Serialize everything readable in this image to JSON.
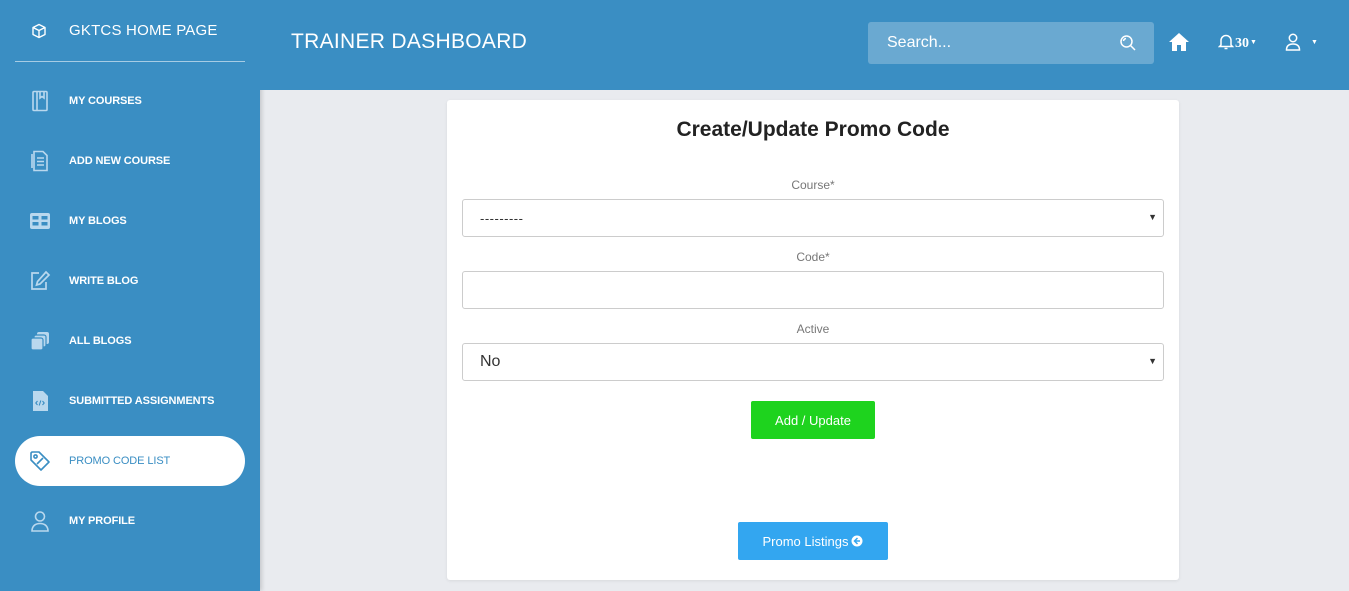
{
  "brand": {
    "label": "GKTCS HOME PAGE",
    "icon": "cube-icon"
  },
  "sidebar": {
    "items": [
      {
        "label": "MY COURSES",
        "icon": "book-icon",
        "active": false
      },
      {
        "label": "ADD NEW COURSE",
        "icon": "document-icon",
        "active": false
      },
      {
        "label": "MY BLOGS",
        "icon": "grid-icon",
        "active": false
      },
      {
        "label": "WRITE BLOG",
        "icon": "edit-icon",
        "active": false
      },
      {
        "label": "ALL BLOGS",
        "icon": "copy-icon",
        "active": false
      },
      {
        "label": "SUBMITTED ASSIGNMENTS",
        "icon": "code-file-icon",
        "active": false
      },
      {
        "label": "PROMO CODE LIST",
        "icon": "tag-icon",
        "active": true
      },
      {
        "label": "MY PROFILE",
        "icon": "user-icon",
        "active": false
      }
    ]
  },
  "header": {
    "title": "TRAINER DASHBOARD",
    "search_placeholder": "Search...",
    "notification_count": "30",
    "icons": [
      "search-icon",
      "home-icon",
      "bell-icon",
      "user-icon"
    ]
  },
  "form": {
    "title": "Create/Update Promo Code",
    "course_label": "Course*",
    "course_value": "---------",
    "code_label": "Code*",
    "code_value": "",
    "active_label": "Active",
    "active_value": "No",
    "submit_label": "Add / Update",
    "listings_label": "Promo Listings"
  },
  "colors": {
    "primary": "#3a8ec3",
    "background": "#e9ebef",
    "submit": "#1ed31e",
    "listings": "#33a6f0"
  }
}
